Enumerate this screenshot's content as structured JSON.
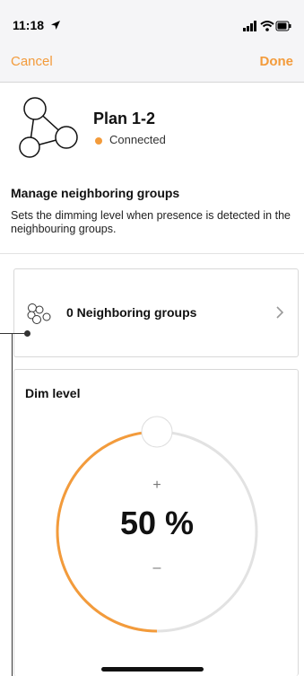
{
  "status_bar": {
    "time": "11:18"
  },
  "nav": {
    "cancel_label": "Cancel",
    "done_label": "Done"
  },
  "header": {
    "plan_name": "Plan 1-2",
    "connection_status": "Connected"
  },
  "neighbors_section": {
    "title": "Manage neighboring groups",
    "description": "Sets the dimming level when presence is detected in the neighbouring groups."
  },
  "neighbor_card": {
    "label": "0 Neighboring groups"
  },
  "dim_card": {
    "title": "Dim level",
    "value_label": "50 %",
    "level_percent": 50,
    "plus_label": "+",
    "minus_label": "–"
  },
  "colors": {
    "accent": "#f39b3b",
    "track": "#e2e2e2"
  },
  "icons": [
    "location-arrow-icon",
    "signal-icon",
    "wifi-icon",
    "battery-icon",
    "group-icon",
    "neighbor-groups-icon",
    "chevron-right-icon"
  ]
}
